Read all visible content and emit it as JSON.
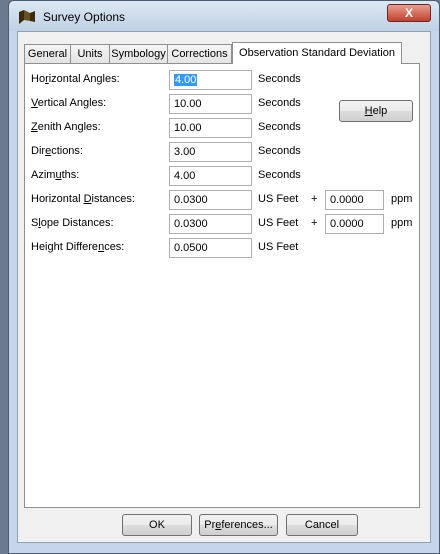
{
  "window": {
    "title": "Survey Options",
    "close_glyph": "X"
  },
  "tabs": [
    {
      "label": "General"
    },
    {
      "label": "Units"
    },
    {
      "label": "Symbology"
    },
    {
      "label": "Corrections"
    },
    {
      "label": "Observation Standard Deviation",
      "active": true
    }
  ],
  "rows": [
    {
      "pre": "Ho",
      "key": "r",
      "post": "izontal Angles:",
      "value": "4.00",
      "selected": true,
      "unit": "Seconds"
    },
    {
      "pre": "",
      "key": "V",
      "post": "ertical Angles:",
      "value": "10.00",
      "unit": "Seconds"
    },
    {
      "pre": "",
      "key": "Z",
      "post": "enith Angles:",
      "value": "10.00",
      "unit": "Seconds"
    },
    {
      "pre": "Dir",
      "key": "e",
      "post": "ctions:",
      "value": "3.00",
      "unit": "Seconds"
    },
    {
      "pre": "Azim",
      "key": "u",
      "post": "ths:",
      "value": "4.00",
      "unit": "Seconds"
    },
    {
      "pre": "Horizontal ",
      "key": "D",
      "post": "istances:",
      "value": "0.0300",
      "unit": "US Feet",
      "plus": "+",
      "ppm_value": "0.0000",
      "ppm_label": "ppm"
    },
    {
      "pre": "S",
      "key": "l",
      "post": "ope Distances:",
      "value": "0.0300",
      "unit": "US Feet",
      "plus": "+",
      "ppm_value": "0.0000",
      "ppm_label": "ppm"
    },
    {
      "pre": "Height Differe",
      "key": "n",
      "post": "ces:",
      "value": "0.0500",
      "unit": "US Feet"
    }
  ],
  "help_button": {
    "key": "H",
    "post": "elp"
  },
  "footer": {
    "ok": "OK",
    "preferences": {
      "pre": "Pr",
      "key": "e",
      "post": "ferences..."
    },
    "cancel": "Cancel"
  },
  "icons": {
    "app": "survey-app-icon",
    "close": "close-icon"
  },
  "colors": {
    "selection": "#3399ff",
    "close_button": "#c0402c",
    "frame": "#c6d6e8"
  }
}
